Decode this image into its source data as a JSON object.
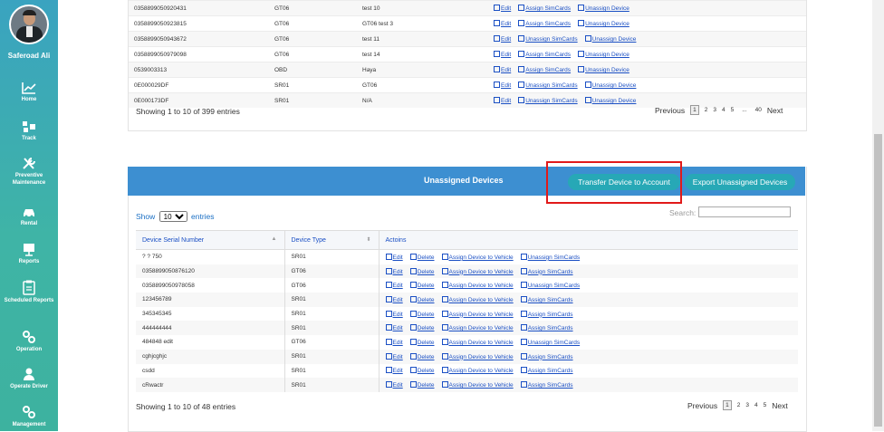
{
  "user": {
    "name": "Saferoad Ali"
  },
  "nav": [
    {
      "label": "Home",
      "icon": "chart-icon"
    },
    {
      "label": "Track",
      "icon": "track-icon"
    },
    {
      "label": "Preventive Maintenance",
      "icon": "wrench-icon"
    },
    {
      "label": "Rental",
      "icon": "car-icon"
    },
    {
      "label": "Reports",
      "icon": "reports-icon"
    },
    {
      "label": "Scheduled Reports",
      "icon": "clipboard-icon"
    },
    {
      "label": "Operation",
      "icon": "gears-icon"
    },
    {
      "label": "Operate Driver",
      "icon": "driver-icon"
    },
    {
      "label": "Management",
      "icon": "gears-icon"
    }
  ],
  "top_table": {
    "rows": [
      {
        "serial": "0358899050920431",
        "type": "GT06",
        "name": "test 10",
        "actions": [
          "Edit",
          "Assign SimCards",
          "Unassign Device"
        ]
      },
      {
        "serial": "0358899050923815",
        "type": "GT06",
        "name": "GT06 test 3",
        "actions": [
          "Edit",
          "Assign SimCards",
          "Unassign Device"
        ]
      },
      {
        "serial": "0358899050943672",
        "type": "GT06",
        "name": "test 11",
        "actions": [
          "Edit",
          "Unassign SimCards",
          "Unassign Device"
        ]
      },
      {
        "serial": "0358899050979098",
        "type": "GT06",
        "name": "test 14",
        "actions": [
          "Edit",
          "Assign SimCards",
          "Unassign Device"
        ]
      },
      {
        "serial": "0539003313",
        "type": "OBD",
        "name": "Haya",
        "actions": [
          "Edit",
          "Assign SimCards",
          "Unassign Device"
        ]
      },
      {
        "serial": "0E000029DF",
        "type": "SR01",
        "name": "GT06",
        "actions": [
          "Edit",
          "Unassign SimCards",
          "Unassign Device"
        ]
      },
      {
        "serial": "0E000173DF",
        "type": "SR01",
        "name": "N/A",
        "actions": [
          "Edit",
          "Unassign SimCards",
          "Unassign Device"
        ]
      }
    ],
    "info": "Showing 1 to 10 of 399 entries",
    "pager": {
      "prev": "Previous",
      "pages": [
        "1",
        "2",
        "3",
        "4",
        "5",
        "...",
        "40"
      ],
      "next": "Next"
    }
  },
  "unassigned": {
    "title": "Unassigned Devices",
    "transfer_button": "Transfer Device to Account",
    "export_button": "Export Unassigned Devices",
    "show_label": "Show",
    "show_value": "10",
    "entries_label": "entries",
    "search_label": "Search:",
    "columns": [
      "Device Serial Number",
      "Device Type",
      "Actoins"
    ],
    "rows": [
      {
        "serial": "? ? 750",
        "type": "SR01",
        "actions": [
          "Edit",
          "Delete",
          "Assign Device to Vehicle",
          "Unassign SimCards"
        ]
      },
      {
        "serial": "0358899050876120",
        "type": "GT06",
        "actions": [
          "Edit",
          "Delete",
          "Assign Device to Vehicle",
          "Assign SimCards"
        ]
      },
      {
        "serial": "0358899050978058",
        "type": "GT06",
        "actions": [
          "Edit",
          "Delete",
          "Assign Device to Vehicle",
          "Unassign SimCards"
        ]
      },
      {
        "serial": "123456789",
        "type": "SR01",
        "actions": [
          "Edit",
          "Delete",
          "Assign Device to Vehicle",
          "Assign SimCards"
        ]
      },
      {
        "serial": "345345345",
        "type": "SR01",
        "actions": [
          "Edit",
          "Delete",
          "Assign Device to Vehicle",
          "Assign SimCards"
        ]
      },
      {
        "serial": "444444444",
        "type": "SR01",
        "actions": [
          "Edit",
          "Delete",
          "Assign Device to Vehicle",
          "Assign SimCards"
        ]
      },
      {
        "serial": "484848 edit",
        "type": "GT06",
        "actions": [
          "Edit",
          "Delete",
          "Assign Device to Vehicle",
          "Unassign SimCards"
        ]
      },
      {
        "serial": "cghjcghjc",
        "type": "SR01",
        "actions": [
          "Edit",
          "Delete",
          "Assign Device to Vehicle",
          "Assign SimCards"
        ]
      },
      {
        "serial": "csdd",
        "type": "SR01",
        "actions": [
          "Edit",
          "Delete",
          "Assign Device to Vehicle",
          "Assign SimCards"
        ]
      },
      {
        "serial": "cRwactr",
        "type": "SR01",
        "actions": [
          "Edit",
          "Delete",
          "Assign Device to Vehicle",
          "Assign SimCards"
        ]
      }
    ],
    "info": "Showing 1 to 10 of 48 entries",
    "pager": {
      "prev": "Previous",
      "pages": [
        "1",
        "2",
        "3",
        "4",
        "5"
      ],
      "next": "Next"
    }
  }
}
